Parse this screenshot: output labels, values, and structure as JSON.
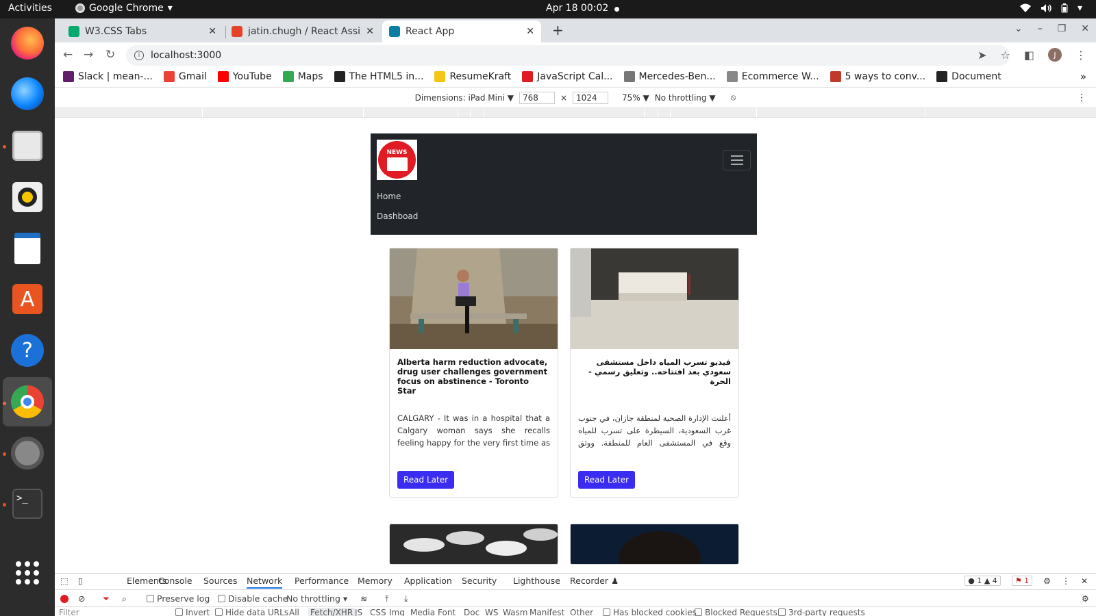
{
  "os": {
    "activities": "Activities",
    "app_menu": "Google Chrome",
    "clock": "Apr 18  00:02"
  },
  "dock": {
    "apps": [
      "firefox-icon",
      "thunderbird-icon",
      "files-icon",
      "rhythmbox-icon",
      "writer-icon",
      "app-center-icon",
      "help-icon",
      "chrome-icon",
      "settings-icon",
      "terminal-icon",
      "show-apps-icon"
    ]
  },
  "browser": {
    "tabs": [
      {
        "title": "W3.CSS Tabs",
        "favicon_color": "#04aa6d"
      },
      {
        "title": "jatin.chugh / React Assign",
        "favicon_color": "#e24329"
      },
      {
        "title": "React App",
        "favicon_color": "#087ea4"
      }
    ],
    "url": "localhost:3000",
    "avatar_initial": "J",
    "bookmarks": [
      {
        "label": "Slack | mean-...",
        "color": "#611f69"
      },
      {
        "label": "Gmail",
        "color": "#ea4335"
      },
      {
        "label": "YouTube",
        "color": "#ff0000"
      },
      {
        "label": "Maps",
        "color": "#34a853"
      },
      {
        "label": "The HTML5 in...",
        "color": "#222222"
      },
      {
        "label": "ResumeKraft",
        "color": "#f5c518"
      },
      {
        "label": "JavaScript Cal...",
        "color": "#e01b24"
      },
      {
        "label": "Mercedes-Ben...",
        "color": "#777777"
      },
      {
        "label": "Ecommerce W...",
        "color": "#888888"
      },
      {
        "label": "5 ways to conv...",
        "color": "#c0392b"
      },
      {
        "label": "Document",
        "color": "#222222"
      }
    ]
  },
  "device_toolbar": {
    "dimensions_label": "Dimensions: iPad Mini ▼",
    "width": "768",
    "times": "×",
    "height": "1024",
    "zoom": "75% ▼",
    "throttle": "No throttling ▼"
  },
  "app": {
    "logo_text": "NEWS",
    "nav": {
      "home": "Home",
      "dashboard": "Dashboad"
    },
    "cards": [
      {
        "title": "Alberta harm reduction advocate, drug user challenges government focus on abstinence - Toronto Star",
        "description": "CALGARY - It was in a hospital that a Calgary woman says she recalls feeling happy for the very first time as an opioid",
        "button": "Read Later"
      },
      {
        "title": "فيديو تسرب المياه داخل مستشفى سعودي بعد افتتاحه.. وتعليق رسمي - الحرة",
        "description": "أعلنت الإدارة الصحية لمنطقة جازان، في جنوب غرب السعودية، السيطرة على تسرب للمياه وقع في المستشفى العام للمنطقة. ووثق مقطع",
        "button": "Read Later"
      }
    ]
  },
  "devtools": {
    "tabs": [
      "Elements",
      "Console",
      "Sources",
      "Network",
      "Performance",
      "Memory",
      "Application",
      "Security",
      "Lighthouse",
      "Recorder ♟"
    ],
    "active_tab": "Network",
    "errors": "● 1",
    "warnings": "▲ 4",
    "issues": "1",
    "toolbar": {
      "preserve_log": "Preserve log",
      "disable_cache": "Disable cache",
      "throttling": "No throttling"
    },
    "filter": {
      "placeholder": "Filter",
      "invert": "Invert",
      "hide_data_urls": "Hide data URLs",
      "types": [
        "All",
        "Fetch/XHR",
        "JS",
        "CSS",
        "Img",
        "Media",
        "Font",
        "Doc",
        "WS",
        "Wasm",
        "Manifest",
        "Other"
      ],
      "has_blocked_cookies": "Has blocked cookies",
      "blocked_requests": "Blocked Requests",
      "third_party": "3rd-party requests"
    }
  }
}
